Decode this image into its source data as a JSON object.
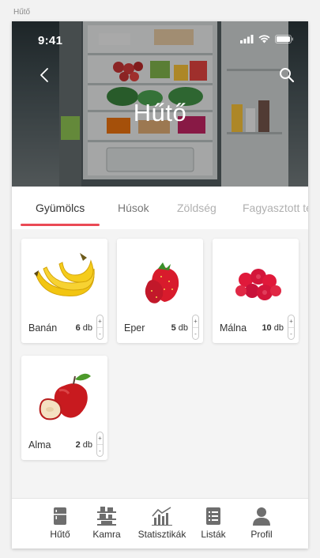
{
  "frame_title": "Hűtő",
  "status": {
    "time": "9:41"
  },
  "header": {
    "title": "Hűtő"
  },
  "tabs": [
    {
      "label": "Gyümölcs",
      "active": true
    },
    {
      "label": "Húsok",
      "active": false
    },
    {
      "label": "Zöldség",
      "active": false
    },
    {
      "label": "Fagyasztott termékek",
      "active": false
    }
  ],
  "items": [
    {
      "name": "Banán",
      "qty": "6",
      "unit": "db",
      "icon": "banana-image"
    },
    {
      "name": "Eper",
      "qty": "5",
      "unit": "db",
      "icon": "strawberry-image"
    },
    {
      "name": "Málna",
      "qty": "10",
      "unit": "db",
      "icon": "raspberry-image"
    },
    {
      "name": "Alma",
      "qty": "2",
      "unit": "db",
      "icon": "apple-image"
    }
  ],
  "stepper": {
    "plus": "+",
    "minus": "-"
  },
  "nav": [
    {
      "label": "Hűtő",
      "icon": "fridge-icon"
    },
    {
      "label": "Kamra",
      "icon": "pantry-icon"
    },
    {
      "label": "Statisztikák",
      "icon": "statistics-icon"
    },
    {
      "label": "Listák",
      "icon": "list-icon"
    },
    {
      "label": "Profil",
      "icon": "profile-icon"
    }
  ],
  "colors": {
    "accent": "#ea4a55",
    "nav_icon": "#6e6e6e"
  }
}
